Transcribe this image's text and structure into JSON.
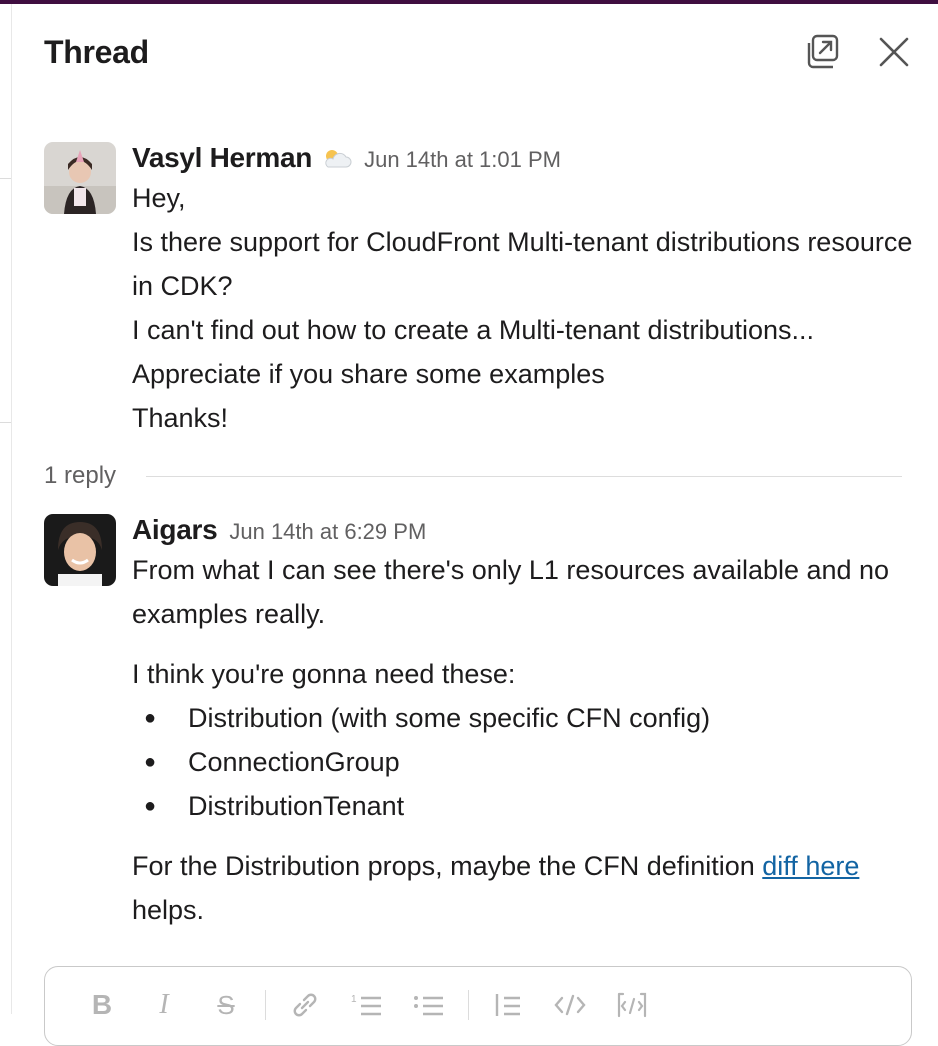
{
  "panel": {
    "title": "Thread",
    "popout_icon": "popout-icon",
    "close_icon": "close-icon"
  },
  "messages": [
    {
      "author": "Vasyl Herman",
      "status_icon": "sun-behind-cloud-icon",
      "timestamp": "Jun 14th at 1:01 PM",
      "lines": [
        "Hey,",
        "Is there support for CloudFront Multi-tenant distributions resource in CDK?",
        "I can't find out how to create a Multi-tenant distributions...",
        "Appreciate if you share some examples",
        "Thanks!"
      ]
    },
    {
      "author": "Aigars",
      "timestamp": "Jun 14th at 6:29 PM",
      "paragraph1": "From what I can see there's only L1 resources available and no examples really.",
      "paragraph2": "I think you're gonna need these:",
      "bullets": [
        "Distribution (with some specific CFN config)",
        "ConnectionGroup",
        "DistributionTenant"
      ],
      "paragraph3_prefix": "For the Distribution props, maybe the CFN definition ",
      "paragraph3_link": "diff here",
      "paragraph3_suffix": " helps."
    }
  ],
  "replies": {
    "count_label": "1 reply"
  },
  "composer": {
    "toolbar": [
      "bold-icon",
      "italic-icon",
      "strikethrough-icon",
      "link-icon",
      "ordered-list-icon",
      "bulleted-list-icon",
      "blockquote-icon",
      "code-icon",
      "code-block-icon"
    ]
  },
  "colors": {
    "accent_bar": "#3f0e40",
    "link": "#1264a3",
    "muted_text": "#616061"
  }
}
